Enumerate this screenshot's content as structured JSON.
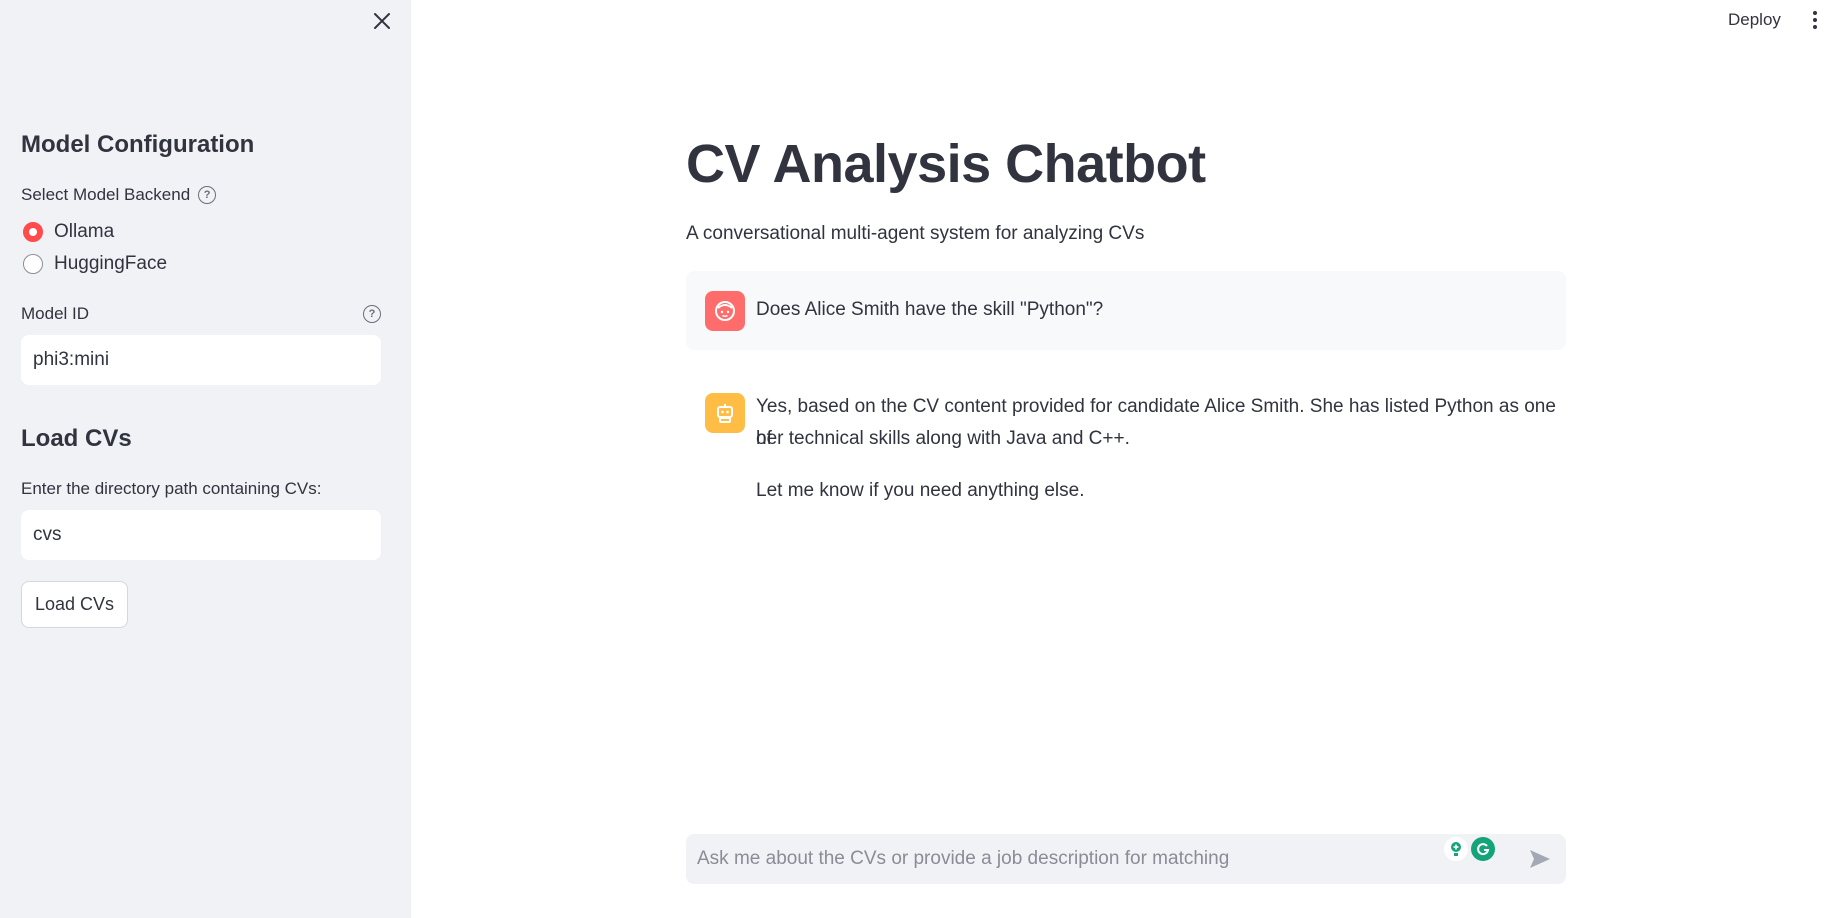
{
  "sidebar": {
    "model_config_heading": "Model Configuration",
    "backend_label": "Select Model Backend",
    "backend_options": [
      "Ollama",
      "HuggingFace"
    ],
    "backend_selected": "Ollama",
    "model_id_label": "Model ID",
    "model_id_value": "phi3:mini",
    "load_heading": "Load CVs",
    "directory_label": "Enter the directory path containing CVs:",
    "directory_value": "cvs",
    "load_button": "Load CVs"
  },
  "header": {
    "deploy_label": "Deploy"
  },
  "main": {
    "title": "CV Analysis Chatbot",
    "subtitle": "A conversational multi-agent system for analyzing CVs",
    "messages": [
      {
        "role": "user",
        "paragraphs": [
          "Does Alice Smith have the skill \"Python\"?"
        ]
      },
      {
        "role": "assistant",
        "paragraphs": [
          "Yes, based on the CV content provided for candidate Alice Smith. She has listed Python as one of",
          "her technical skills along with Java and C++.",
          "Let me know if you need anything else."
        ]
      }
    ],
    "chat_placeholder": "Ask me about the CVs or provide a job description for matching"
  },
  "colors": {
    "accent": "#ff4b4b",
    "user_avatar": "#ff6c6c",
    "bot_avatar": "#ffbd45",
    "sidebar_bg": "#f0f2f6"
  },
  "icons": [
    "close-icon",
    "help-icon",
    "user-avatar-icon",
    "bot-avatar-icon",
    "send-icon",
    "kebab-menu-icon",
    "extension-icon",
    "grammarly-icon"
  ]
}
